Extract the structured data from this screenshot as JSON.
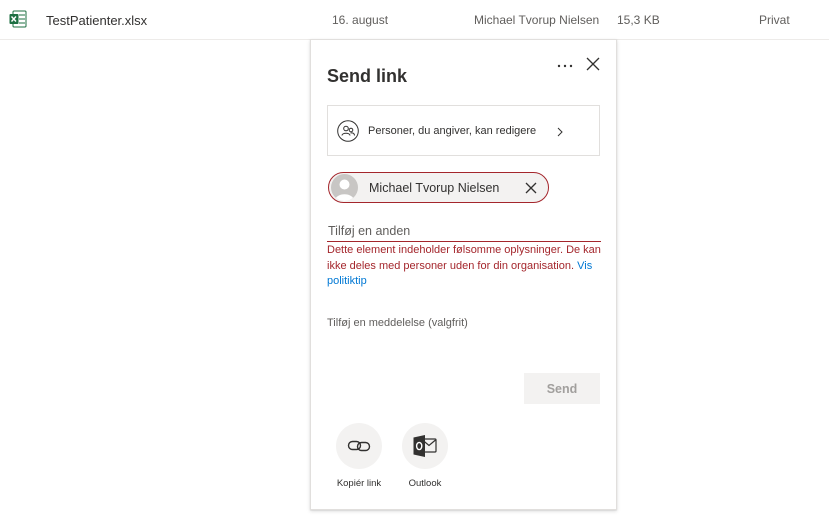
{
  "file_row": {
    "name": "TestPatienter.xlsx",
    "modified": "16. august",
    "modified_by": "Michael Tvorup Nielsen",
    "size": "15,3 KB",
    "sharing": "Privat",
    "icon": "excel-file-icon"
  },
  "dialog": {
    "title": "Send link",
    "more_icon": "more-ellipsis-icon",
    "close_icon": "close-icon",
    "permission": {
      "text": "Personer, du angiver, kan redigere",
      "icon": "people-icon"
    },
    "recipient": {
      "name": "Michael Tvorup Nielsen",
      "icon": "avatar"
    },
    "add_placeholder": "Tilføj en anden",
    "error": {
      "message": "Dette element indeholder følsomme oplysninger. De kan ikke deles med personer uden for din organisation.",
      "link": "Vis politiktip"
    },
    "message_placeholder": "Tilføj en meddelelse (valgfrit)",
    "send_label": "Send",
    "share_options": [
      {
        "label": "Kopiér link",
        "icon": "link-icon"
      },
      {
        "label": "Outlook",
        "icon": "outlook-icon"
      }
    ]
  },
  "colors": {
    "error": "#a4262c",
    "link": "#0078d4",
    "excel_green": "#1d6f42"
  }
}
